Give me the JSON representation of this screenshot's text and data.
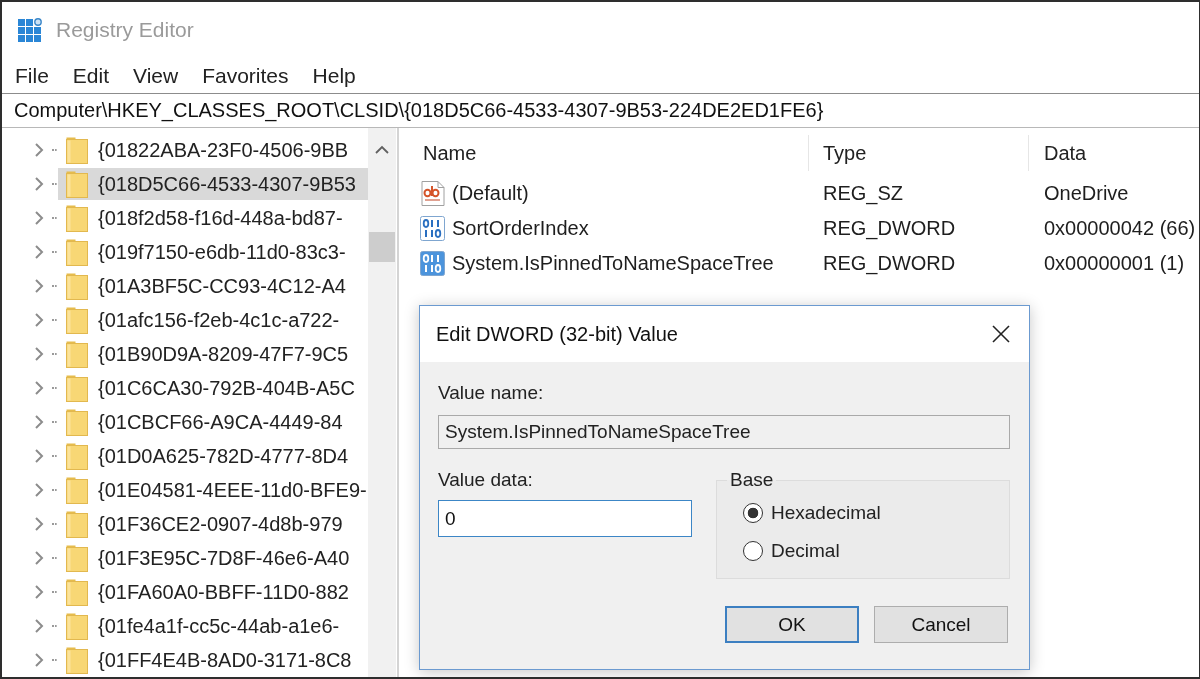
{
  "window": {
    "title": "Registry Editor"
  },
  "menu": [
    "File",
    "Edit",
    "View",
    "Favorites",
    "Help"
  ],
  "address_bar": {
    "value": "Computer\\HKEY_CLASSES_ROOT\\CLSID\\{018D5C66-4533-4307-9B53-224DE2ED1FE6}"
  },
  "tree": {
    "items": [
      {
        "label": "{01822ABA-23F0-4506-9BB",
        "expanded": false,
        "selected": false
      },
      {
        "label": "{018D5C66-4533-4307-9B53",
        "expanded": false,
        "selected": true
      },
      {
        "label": "{018f2d58-f16d-448a-bd87-",
        "expanded": false,
        "selected": false
      },
      {
        "label": "{019f7150-e6db-11d0-83c3-",
        "expanded": false,
        "selected": false
      },
      {
        "label": "{01A3BF5C-CC93-4C12-A4",
        "expanded": false,
        "selected": false
      },
      {
        "label": "{01afc156-f2eb-4c1c-a722-",
        "expanded": false,
        "selected": false
      },
      {
        "label": "{01B90D9A-8209-47F7-9C5",
        "expanded": false,
        "selected": false
      },
      {
        "label": "{01C6CA30-792B-404B-A5C",
        "expanded": false,
        "selected": false
      },
      {
        "label": "{01CBCF66-A9CA-4449-84",
        "expanded": false,
        "selected": false
      },
      {
        "label": "{01D0A625-782D-4777-8D4",
        "expanded": false,
        "selected": false
      },
      {
        "label": "{01E04581-4EEE-11d0-BFE9-",
        "expanded": false,
        "selected": false
      },
      {
        "label": "{01F36CE2-0907-4d8b-979",
        "expanded": false,
        "selected": false
      },
      {
        "label": "{01F3E95C-7D8F-46e6-A40",
        "expanded": false,
        "selected": false
      },
      {
        "label": "{01FA60A0-BBFF-11D0-882",
        "expanded": false,
        "selected": false
      },
      {
        "label": "{01fe4a1f-cc5c-44ab-a1e6-",
        "expanded": false,
        "selected": false
      },
      {
        "label": "{01FF4E4B-8AD0-3171-8C8",
        "expanded": false,
        "selected": false
      }
    ]
  },
  "values_table": {
    "columns": [
      "Name",
      "Type",
      "Data"
    ],
    "rows": [
      {
        "kind": "string",
        "name": "(Default)",
        "type": "REG_SZ",
        "data": "OneDrive",
        "selected": false
      },
      {
        "kind": "binary",
        "name": "SortOrderIndex",
        "type": "REG_DWORD",
        "data": "0x00000042 (66)",
        "selected": false
      },
      {
        "kind": "binary",
        "name": "System.IsPinnedToNameSpaceTree",
        "type": "REG_DWORD",
        "data": "0x00000001 (1)",
        "selected": true
      }
    ]
  },
  "dialog": {
    "title": "Edit DWORD (32-bit) Value",
    "value_name_label": "Value name:",
    "value_name": {
      "value": "System.IsPinnedToNameSpaceTree",
      "disabled": true
    },
    "value_data_label": "Value data:",
    "value_data": {
      "value": "0",
      "focused": true
    },
    "base": {
      "label": "Base",
      "options": [
        {
          "label": "Hexadecimal",
          "selected": true
        },
        {
          "label": "Decimal",
          "selected": false
        }
      ]
    },
    "buttons": [
      {
        "label": "OK",
        "default": true
      },
      {
        "label": "Cancel",
        "default": false
      }
    ]
  }
}
